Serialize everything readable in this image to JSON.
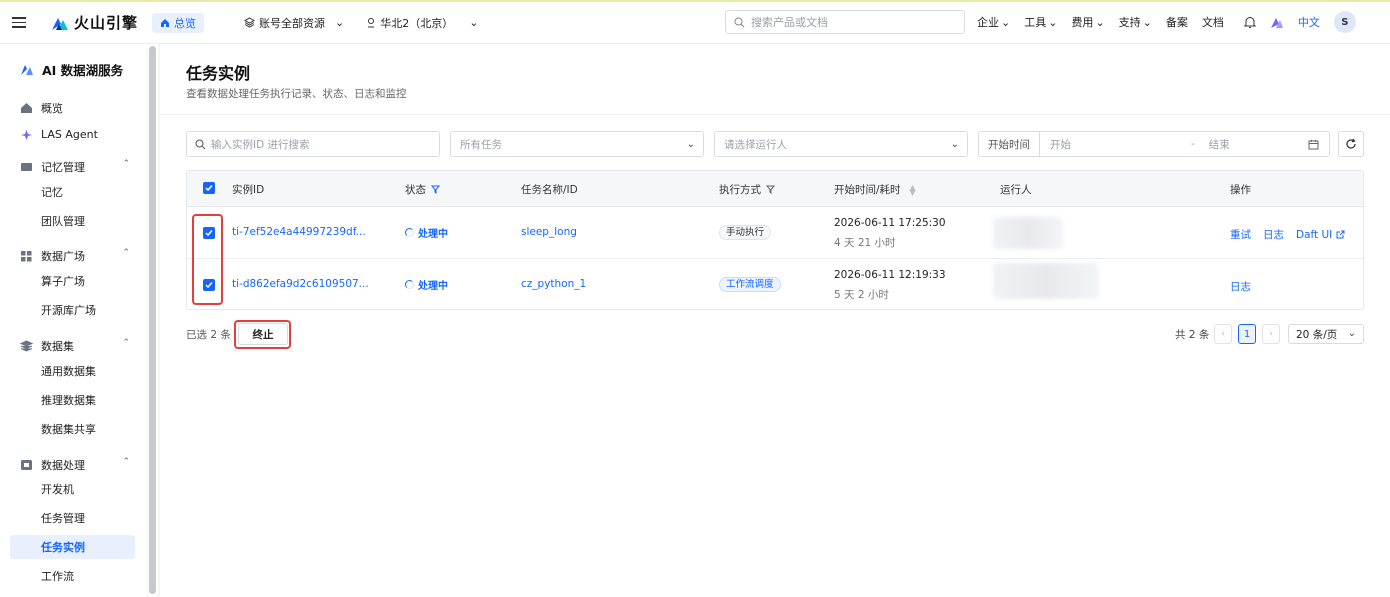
{
  "topbar": {
    "brand": "火山引擎",
    "home_label": "总览",
    "account_scope": "账号全部资源",
    "region": "华北2（北京）",
    "search_placeholder": "搜索产品或文档",
    "nav": [
      "企业",
      "工具",
      "费用",
      "支持"
    ],
    "filing": "备案",
    "docs": "文档",
    "language": "中文",
    "avatar_initial": "S"
  },
  "sidebar": {
    "service_title": "AI 数据湖服务",
    "overview": "概览",
    "las_agent": "LAS Agent",
    "groups": {
      "memory": {
        "label": "记忆管理",
        "items": [
          "记忆",
          "团队管理"
        ]
      },
      "market": {
        "label": "数据广场",
        "items": [
          "算子广场",
          "开源库广场"
        ]
      },
      "dataset": {
        "label": "数据集",
        "items": [
          "通用数据集",
          "推理数据集",
          "数据集共享"
        ]
      },
      "processing": {
        "label": "数据处理",
        "items": [
          "开发机",
          "任务管理",
          "任务实例",
          "工作流"
        ]
      }
    },
    "active_item": "任务实例"
  },
  "page": {
    "title": "任务实例",
    "description": "查看数据处理任务执行记录、状态、日志和监控"
  },
  "filters": {
    "instance_search_placeholder": "输入实例ID 进行搜索",
    "task_select": "所有任务",
    "runner_placeholder": "请选择运行人",
    "start_time_label": "开始时间",
    "start_placeholder": "开始",
    "range_separator": "-",
    "end_placeholder": "结束"
  },
  "table": {
    "columns": {
      "instance_id": "实例ID",
      "status": "状态",
      "task_name": "任务名称/ID",
      "exec_mode": "执行方式",
      "start_time": "开始时间/耗时",
      "runner": "运行人",
      "actions": "操作"
    },
    "rows": [
      {
        "instance_id": "ti-7ef52e4a44997239df...",
        "status": "处理中",
        "task_name": "sleep_long",
        "exec_mode": "手动执行",
        "start_time": "2026-06-11 17:25:30",
        "duration": "4 天 21 小时",
        "actions": [
          "重试",
          "日志",
          "Daft UI"
        ]
      },
      {
        "instance_id": "ti-d862efa9d2c6109507...",
        "status": "处理中",
        "task_name": "cz_python_1",
        "exec_mode": "工作流调度",
        "start_time": "2026-06-11 12:19:33",
        "duration": "5 天 2 小时",
        "actions": [
          "日志"
        ]
      }
    ]
  },
  "footer": {
    "selected_text": "已选 2 条",
    "stop_button": "终止",
    "total_text": "共 2 条",
    "current_page": "1",
    "page_size": "20 条/页"
  },
  "colors": {
    "primary": "#1664ff",
    "highlight": "#e0413e"
  }
}
